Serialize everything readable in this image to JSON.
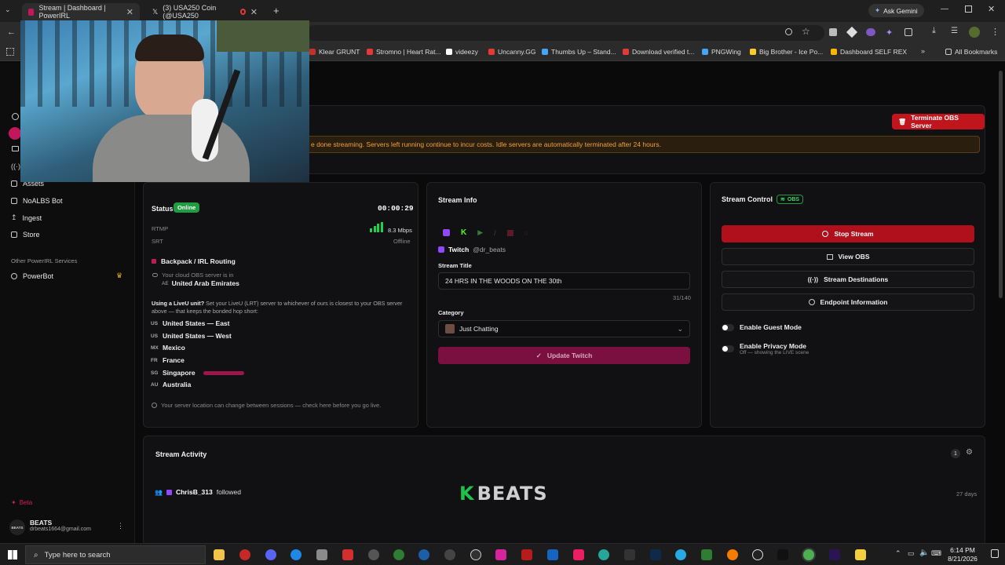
{
  "browser": {
    "tabs": [
      {
        "title": "Stream | Dashboard | PowerIRL",
        "active": true
      },
      {
        "title": "(3) USA250 Coin (@USA250",
        "active": false
      }
    ],
    "ask_gemini": "Ask Gemini",
    "bookmarks": [
      {
        "label": "Klear GRUNT",
        "color": "#c4302b"
      },
      {
        "label": "Stromno | Heart Rat...",
        "color": "#e53935"
      },
      {
        "label": "videezy",
        "color": "#ffffff"
      },
      {
        "label": "Uncanny.GG",
        "color": "#e53935"
      },
      {
        "label": "Thumbs Up – Stand...",
        "color": "#42a5f5"
      },
      {
        "label": "Download verified t...",
        "color": "#e53935"
      },
      {
        "label": "PNGWing",
        "color": "#42a5f5"
      },
      {
        "label": "Big Brother - Ice Po...",
        "color": "#ffca28"
      },
      {
        "label": "Dashboard SELF REX",
        "color": "#ffb300"
      }
    ],
    "all_bookmarks": "All Bookmarks"
  },
  "sidebar": {
    "items": [
      {
        "label": "Assets"
      },
      {
        "label": "NoALBS Bot"
      },
      {
        "label": "Ingest"
      },
      {
        "label": "Store"
      }
    ],
    "other_section": "Other PowerIRL Services",
    "other_items": [
      {
        "label": "PowerBot"
      }
    ],
    "beta": "Beta",
    "user": {
      "name": "BEATS",
      "email": "drbeats1664@gmail.com",
      "avatar_text": "BEATS"
    }
  },
  "banner": {
    "terminate_label": "Terminate OBS Server",
    "warning": "e done streaming. Servers left running continue to incur costs. Idle servers are automatically terminated after 24 hours."
  },
  "status_card": {
    "status_label": "Status",
    "status_value": "Online",
    "timer": "00:00:29",
    "rtmp_label": "RTMP",
    "bitrate": "8.3 Mbps",
    "srt_label": "SRT",
    "srt_value": "Offline",
    "routing_title": "Backpack / IRL Routing",
    "routing_desc": "Your cloud OBS server is in",
    "routing_cc": "AE",
    "routing_location": "United Arab Emirates",
    "liveu_bold": "Using a LiveU unit?",
    "liveu_text": " Set your LiveU (LRT) server to whichever of ours is closest to your OBS server above — that keeps the bonded hop short:",
    "regions": [
      {
        "cc": "US",
        "name": "United States — East"
      },
      {
        "cc": "US",
        "name": "United States — West"
      },
      {
        "cc": "MX",
        "name": "Mexico"
      },
      {
        "cc": "FR",
        "name": "France"
      },
      {
        "cc": "SG",
        "name": "Singapore"
      },
      {
        "cc": "AU",
        "name": "Australia"
      }
    ],
    "footer_note": "Your server location can change between sessions — check here before you go live."
  },
  "stream_info": {
    "title": "Stream Info",
    "platform": "Twitch",
    "handle": "@dr_beats",
    "stream_title_label": "Stream Title",
    "stream_title_value": "24 HRS IN THE WOODS ON THE 30th",
    "char_count": "31/140",
    "category_label": "Category",
    "category_value": "Just Chatting",
    "update_label": "Update Twitch"
  },
  "stream_control": {
    "title": "Stream Control",
    "badge": "OBS",
    "stop_label": "Stop Stream",
    "view_obs_label": "View OBS",
    "destinations_label": "Stream Destinations",
    "endpoint_label": "Endpoint Information",
    "guest_label": "Enable Guest Mode",
    "privacy_label": "Enable Privacy Mode",
    "privacy_sub": "Off — showing the LIVE scene"
  },
  "activity": {
    "title": "Stream Activity",
    "count": "1",
    "event_user": "ChrisB_313",
    "event_action": "followed",
    "event_time": "27 days",
    "watermark": "BEATS"
  },
  "taskbar": {
    "search_placeholder": "Type here to search",
    "time": "6:14 PM",
    "date": "8/21/2026"
  },
  "colors": {
    "accent_red": "#c0151c",
    "accent_pink": "#7a1040",
    "green": "#1f9d3f",
    "warning": "#f0a23a"
  }
}
